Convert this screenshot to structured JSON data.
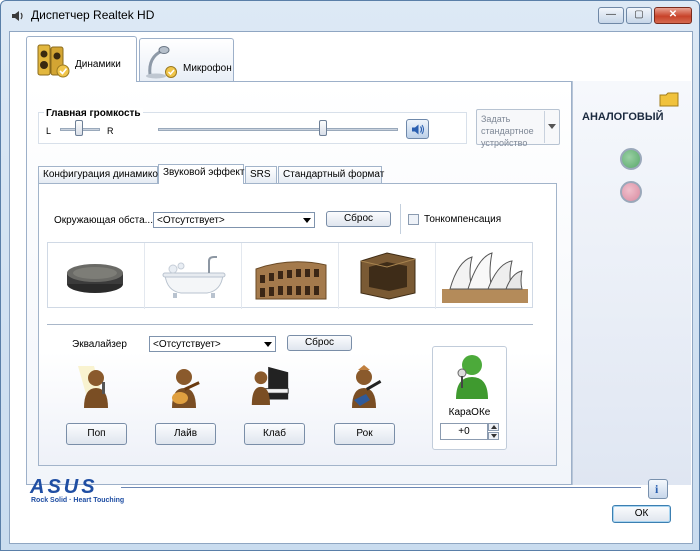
{
  "window": {
    "title": "Диспетчер Realtek HD"
  },
  "tabs": [
    {
      "label": "Динамики"
    },
    {
      "label": "Микрофон"
    }
  ],
  "volume": {
    "label": "Главная громкость",
    "left_label": "L",
    "right_label": "R",
    "balance_position": 0.5,
    "volume_level": 0.83
  },
  "default_device": {
    "label": "Задать стандартное устройство"
  },
  "subtabs": [
    {
      "label": "Конфигурация динамиков"
    },
    {
      "label": "Звуковой эффект"
    },
    {
      "label": "SRS"
    },
    {
      "label": "Стандартный формат"
    }
  ],
  "environment": {
    "label": "Окружающая обста...",
    "selected": "<Отсутствует>",
    "reset_label": "Сброс",
    "tone_comp_label": "Тонкомпенсация",
    "icons": [
      "stone-disc-icon",
      "bathtub-icon",
      "colosseum-icon",
      "stone-box-icon",
      "opera-house-icon"
    ]
  },
  "equalizer": {
    "label": "Эквалайзер",
    "selected": "<Отсутствует>",
    "reset_label": "Сброс",
    "presets": [
      {
        "label": "Поп",
        "icon": "pop-singer-icon"
      },
      {
        "label": "Лайв",
        "icon": "guitar-player-icon"
      },
      {
        "label": "Клаб",
        "icon": "piano-player-icon"
      },
      {
        "label": "Рок",
        "icon": "rock-guitar-icon"
      }
    ]
  },
  "karaoke": {
    "label": "КараОКе",
    "value": "+0"
  },
  "right_panel": {
    "title": "АНАЛОГОВЫЙ"
  },
  "footer": {
    "brand": "ASUS",
    "slogan": "Rock Solid · Heart Touching",
    "ok_label": "ОК"
  },
  "colors": {
    "accent": "#3a6db5",
    "jack_green": "#58a86a",
    "jack_pink": "#d98aa0",
    "close_red": "#c8432a"
  }
}
